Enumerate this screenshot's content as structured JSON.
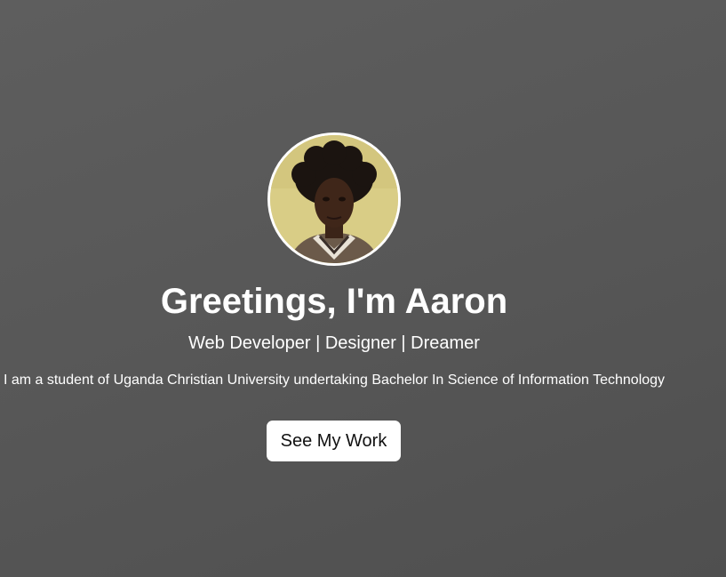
{
  "hero": {
    "title": "Greetings, I'm Aaron",
    "subtitle": "Web Developer | Designer | Dreamer",
    "bio": "I am a student of Uganda Christian University undertaking Bachelor In Science of Information Technology",
    "cta_label": "See My Work"
  },
  "colors": {
    "background": "#575757",
    "text": "#ffffff",
    "button_bg": "#ffffff",
    "button_text": "#111111"
  }
}
